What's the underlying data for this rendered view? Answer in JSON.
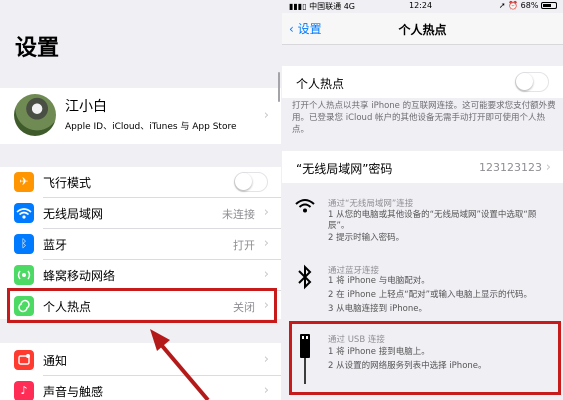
{
  "left": {
    "title": "设置",
    "profile": {
      "name": "江小白",
      "subtitle": "Apple ID、iCloud、iTunes 与 App Store"
    },
    "items": [
      {
        "label": "飞行模式",
        "value": "",
        "icon": "airplane-icon",
        "color": "#ff9500"
      },
      {
        "label": "无线局域网",
        "value": "未连接",
        "icon": "wifi-icon",
        "color": "#007aff"
      },
      {
        "label": "蓝牙",
        "value": "打开",
        "icon": "bluetooth-icon",
        "color": "#007aff"
      },
      {
        "label": "蜂窝移动网络",
        "value": "",
        "icon": "cellular-icon",
        "color": "#4cd964"
      },
      {
        "label": "个人热点",
        "value": "关闭",
        "icon": "hotspot-icon",
        "color": "#4cd964"
      }
    ],
    "items2": [
      {
        "label": "通知",
        "icon": "notifications-icon",
        "color": "#ff3b30"
      },
      {
        "label": "声音与触感",
        "icon": "sounds-icon",
        "color": "#ff2d55"
      }
    ],
    "airplane_mode_on": false
  },
  "right": {
    "status": {
      "carrier": "中国联通",
      "network": "4G",
      "time": "12:24",
      "battery": "68%"
    },
    "nav": {
      "back": "设置",
      "title": "个人热点"
    },
    "hotspot_label": "个人热点",
    "hotspot_on": false,
    "description": "打开个人热点以共享 iPhone 的互联网连接。这可能要求您支付额外费用。已登录您 iCloud 帐户的其他设备无需手动打开即可使用个人热点。",
    "password": {
      "label": "“无线局域网”密码",
      "value": "123123123"
    },
    "methods": [
      {
        "icon": "wifi-icon",
        "title": "通过“无线局域网”连接",
        "lines": [
          "1 从您的电脑或其他设备的“无线局域网”设置中选取“顾辰”。",
          "2 提示时输入密码。"
        ]
      },
      {
        "icon": "bluetooth-icon",
        "title": "通过蓝牙连接",
        "lines": [
          "1 将 iPhone 与电脑配对。",
          "2 在 iPhone 上轻点“配对”或输入电脑上显示的代码。",
          "3 从电脑连接到 iPhone。"
        ]
      },
      {
        "icon": "usb-icon",
        "title": "通过 USB 连接",
        "lines": [
          "1 将 iPhone 接到电脑上。",
          "2 从设置的网络服务列表中选择 iPhone。"
        ]
      }
    ]
  }
}
